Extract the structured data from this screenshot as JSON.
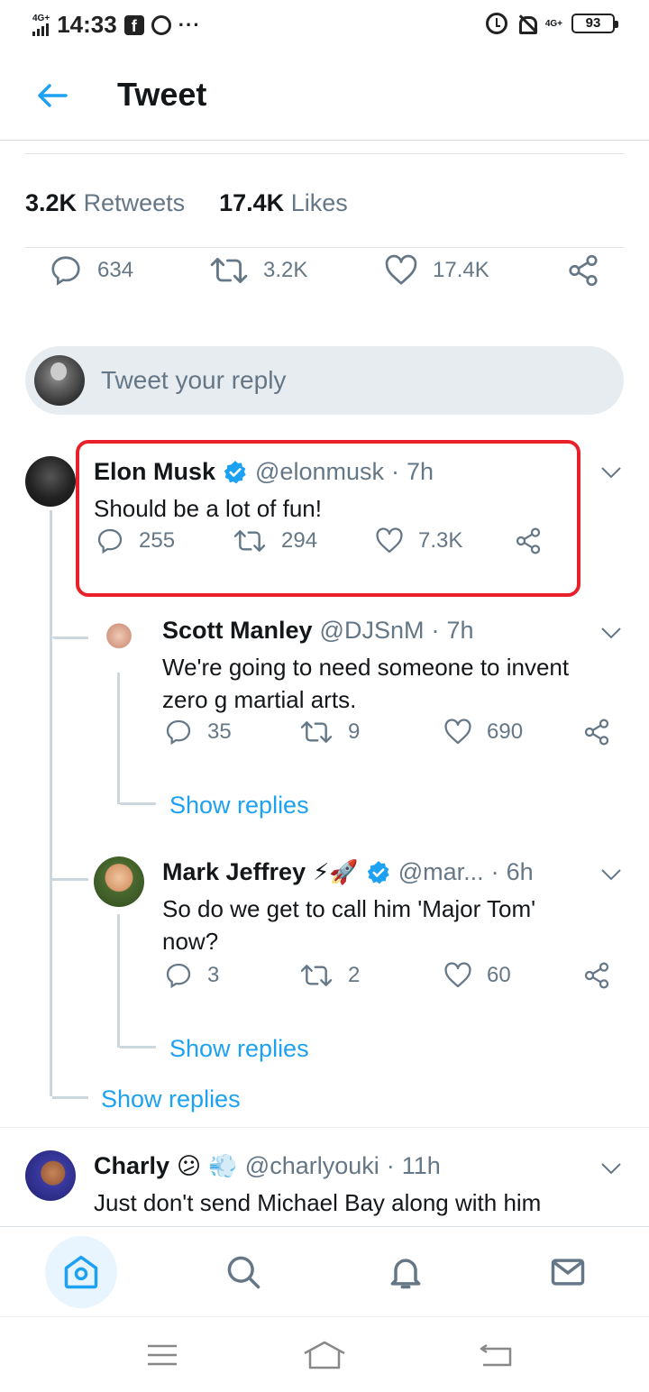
{
  "status_bar": {
    "network": "4G+",
    "time": "14:33",
    "dots": "···",
    "network_right": "4G+",
    "battery": "93"
  },
  "header": {
    "title": "Tweet"
  },
  "stats": {
    "retweets_count": "3.2K",
    "retweets_label": "Retweets",
    "likes_count": "17.4K",
    "likes_label": "Likes"
  },
  "main_actions": {
    "replies": "634",
    "retweets": "3.2K",
    "likes": "17.4K"
  },
  "reply_box": {
    "placeholder": "Tweet your reply"
  },
  "replies": [
    {
      "name": "Elon Musk",
      "handle": "@elonmusk",
      "sep": "·",
      "time": "7h",
      "text": "Should be a lot of fun!",
      "replies": "255",
      "retweets": "294",
      "likes": "7.3K"
    },
    {
      "name": "Scott Manley",
      "handle": "@DJSnM",
      "sep": "·",
      "time": "7h",
      "text": "We're going to need someone to invent zero g martial arts.",
      "replies": "35",
      "retweets": "9",
      "likes": "690",
      "show_replies": "Show replies"
    },
    {
      "name": "Mark Jeffrey",
      "emoji": "⚡🚀",
      "handle": "@mar...",
      "sep": "·",
      "time": "6h",
      "text": "So do we get to call him 'Major Tom' now?",
      "replies": "3",
      "retweets": "2",
      "likes": "60",
      "show_replies": "Show replies"
    },
    {
      "name": "Charly",
      "emoji": "😕 💨",
      "handle": "@charlyouki",
      "sep": "·",
      "time": "11h",
      "text": "Just don't send Michael Bay along with him"
    }
  ],
  "thread_show_replies": "Show replies",
  "accent_color": "#1da1f2",
  "highlight_color": "#e8202a"
}
